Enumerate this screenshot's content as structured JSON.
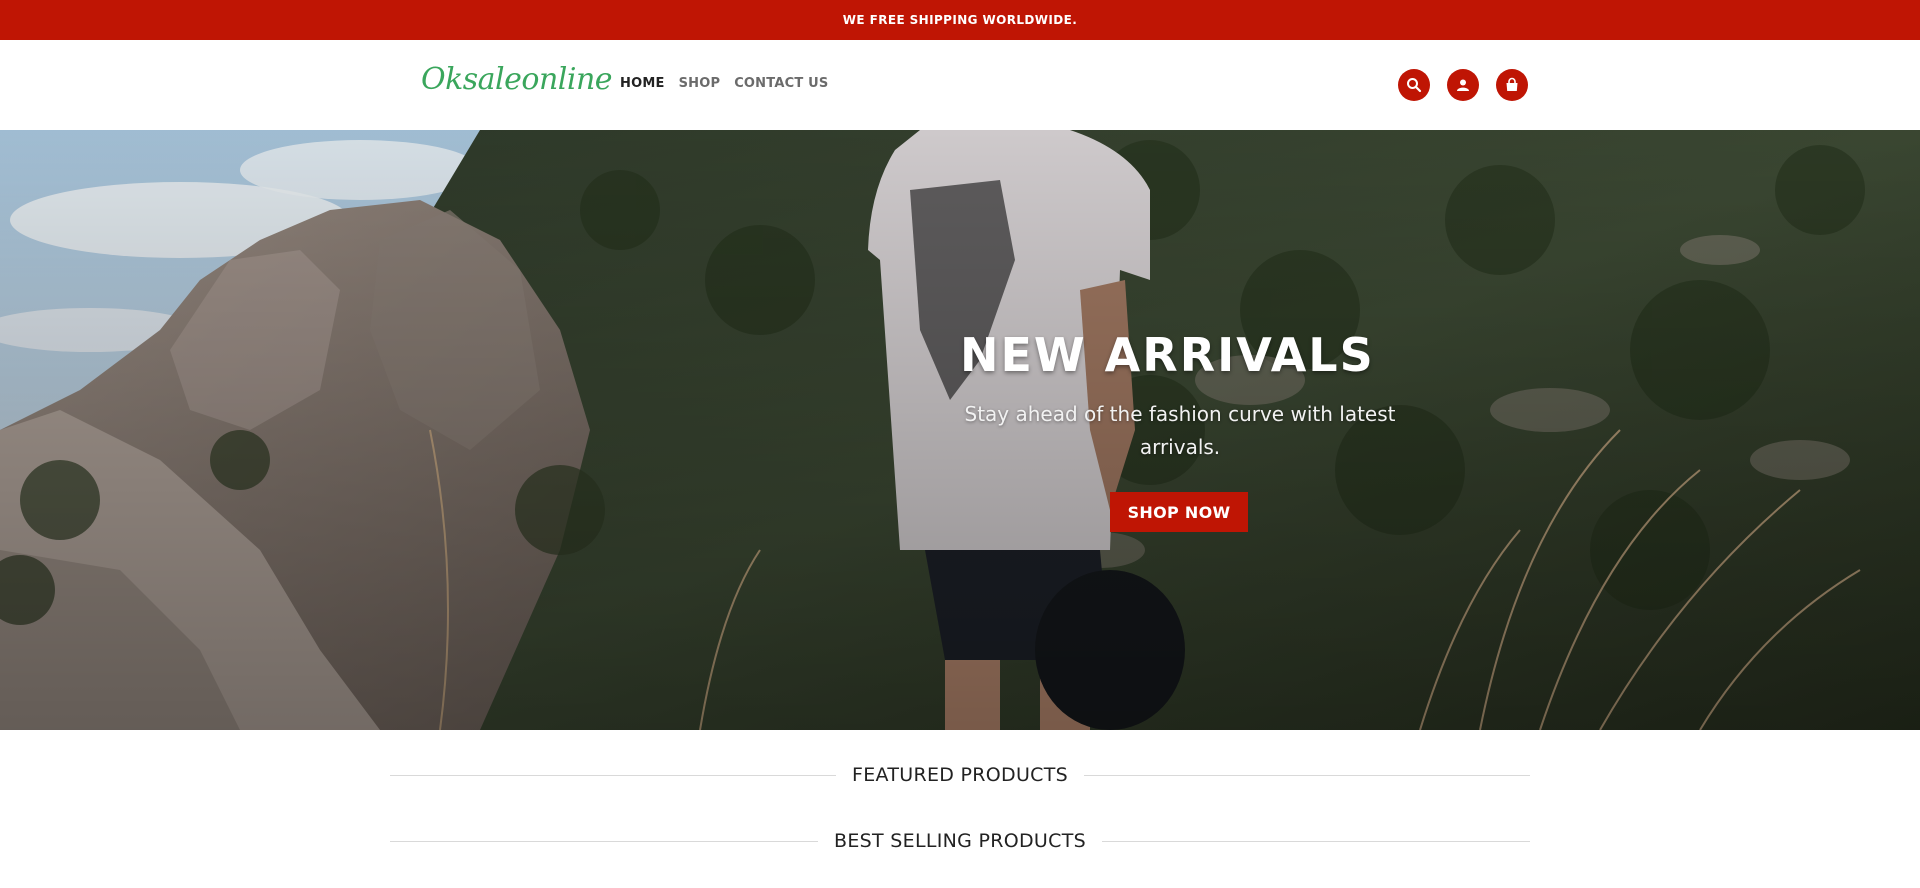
{
  "announcement": {
    "text": "WE FREE SHIPPING WORLDWIDE."
  },
  "header": {
    "logo": "Oksaleonline",
    "nav": [
      {
        "label": "HOME",
        "active": true
      },
      {
        "label": "SHOP",
        "active": false
      },
      {
        "label": "CONTACT US",
        "active": false
      }
    ],
    "icons": [
      "search-icon",
      "account-icon",
      "cart-icon"
    ]
  },
  "hero": {
    "title": "NEW ARRIVALS",
    "subtitle": "Stay ahead of the fashion curve with latest arrivals.",
    "button_label": "SHOP NOW"
  },
  "sections": {
    "featured": "FEATURED PRODUCTS",
    "best_selling": "BEST SELLING PRODUCTS"
  },
  "colors": {
    "accent": "#bf1504",
    "logo": "#3aa65c",
    "divider": "#d9d9d9"
  }
}
